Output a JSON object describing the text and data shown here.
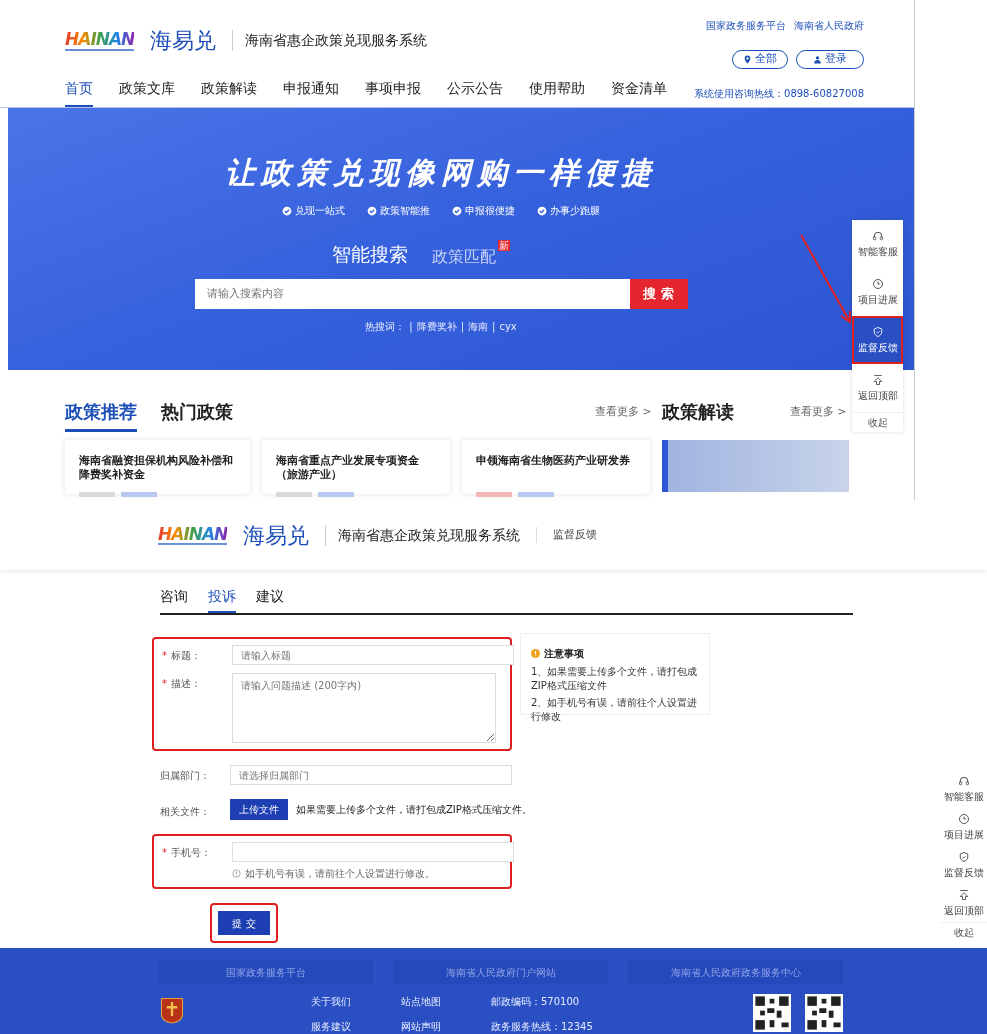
{
  "home_page": {
    "header": {
      "logo_text": "HAINAN",
      "brand": "海易兑",
      "system_title": "海南省惠企政策兑现服务系统",
      "top_links": [
        "国家政务服务平台",
        "海南省人民政府"
      ],
      "region_button": "全部",
      "login_button": "登录",
      "hotline": "系统使用咨询热线：0898-60827008"
    },
    "nav": [
      {
        "label": "首页",
        "selected": true
      },
      {
        "label": "政策文库",
        "selected": false
      },
      {
        "label": "政策解读",
        "selected": false
      },
      {
        "label": "申报通知",
        "selected": false
      },
      {
        "label": "事项申报",
        "selected": false
      },
      {
        "label": "公示公告",
        "selected": false
      },
      {
        "label": "使用帮助",
        "selected": false
      },
      {
        "label": "资金清单",
        "selected": false
      }
    ],
    "hero": {
      "headline": "让政策兑现像网购一样便捷",
      "features": [
        "兑现一站式",
        "政策智能推",
        "申报很便捷",
        "办事少跑腿"
      ],
      "search_tabs": [
        {
          "label": "智能搜索",
          "selected": true
        },
        {
          "label": "政策匹配",
          "selected": false,
          "badge": "新"
        }
      ],
      "search": {
        "placeholder": "请输入搜索内容",
        "button": "搜 索"
      },
      "hot_label": "热搜词：",
      "hot_words": [
        {
          "separator": "|",
          "word": "降费奖补"
        },
        {
          "separator": "|",
          "word": "海南"
        },
        {
          "separator": "|",
          "word": "cyx"
        }
      ]
    },
    "float_toolbar": {
      "items": [
        {
          "kind": "headset",
          "label": "智能客服",
          "selected": false
        },
        {
          "kind": "clock",
          "label": "项目进展",
          "selected": false
        },
        {
          "kind": "shield",
          "label": "监督反馈",
          "selected": true
        },
        {
          "kind": "top",
          "label": "返回顶部",
          "selected": false
        }
      ],
      "collapse": "收起"
    },
    "policy_tabs": [
      {
        "label": "政策推荐",
        "selected": true
      },
      {
        "label": "热门政策",
        "selected": false
      }
    ],
    "more_link": "查看更多 >",
    "interpretation_title": "政策解读",
    "interpretation_more": "查看更多 >",
    "cards": [
      {
        "title": "海南省融资担保机构风险补偿和降费奖补资金",
        "tags": [
          {
            "color": "#d9d9d9"
          },
          {
            "color": "#b9c8f0"
          }
        ]
      },
      {
        "title": "海南省重点产业发展专项资金（旅游产业）",
        "tags": [
          {
            "color": "#d9d9d9"
          },
          {
            "color": "#b9c8f0"
          }
        ]
      },
      {
        "title": "申领海南省生物医药产业研发券",
        "tags": [
          {
            "color": "#f2b8b8"
          },
          {
            "color": "#b9c8f0"
          }
        ]
      }
    ]
  },
  "feedback_page": {
    "header": {
      "logo_text": "HAINAN",
      "brand": "海易兑",
      "system_title": "海南省惠企政策兑现服务系统",
      "page_title": "监督反馈"
    },
    "tabs": [
      {
        "label": "咨询",
        "selected": false
      },
      {
        "label": "投诉",
        "selected": true
      },
      {
        "label": "建议",
        "selected": false
      }
    ],
    "fields": [
      {
        "kind": "input",
        "required_mark": "*",
        "label": "标题：",
        "placeholder": "请输入标题"
      },
      {
        "kind": "textarea",
        "required_mark": "*",
        "label": "描述：",
        "placeholder": "请输入问题描述 (200字内)"
      },
      {
        "kind": "input",
        "label": "归属部门：",
        "placeholder": "请选择归属部门"
      },
      {
        "kind": "upload",
        "label": "相关文件：",
        "button": "上传文件",
        "hint": "如果需要上传多个文件，请打包成ZIP格式压缩文件。"
      },
      {
        "kind": "input",
        "required_mark": "*",
        "label": "手机号：",
        "help": "如手机号有误，请前往个人设置进行修改。"
      }
    ],
    "submit": "提 交",
    "notice": {
      "title": "注意事项",
      "items": [
        "1、如果需要上传多个文件，请打包成ZIP格式压缩文件",
        "2、如手机号有误，请前往个人设置进行修改"
      ]
    },
    "float_toolbar": {
      "items": [
        {
          "kind": "headset",
          "label": "智能客服",
          "selected": false
        },
        {
          "kind": "clock",
          "label": "项目进展",
          "selected": false
        },
        {
          "kind": "shield",
          "label": "监督反馈",
          "selected": false
        },
        {
          "kind": "top",
          "label": "返回顶部",
          "selected": false
        }
      ],
      "collapse": "收起"
    },
    "footer": {
      "site_links": [
        "国家政务服务平台",
        "海南省人民政府门户网站",
        "海南省人民政府政务服务中心"
      ],
      "links": [
        [
          "关于我们",
          "服务建议"
        ],
        [
          "站点地图",
          "网站声明"
        ],
        [
          "邮政编码：570100",
          "政务服务热线：12345"
        ]
      ]
    }
  }
}
